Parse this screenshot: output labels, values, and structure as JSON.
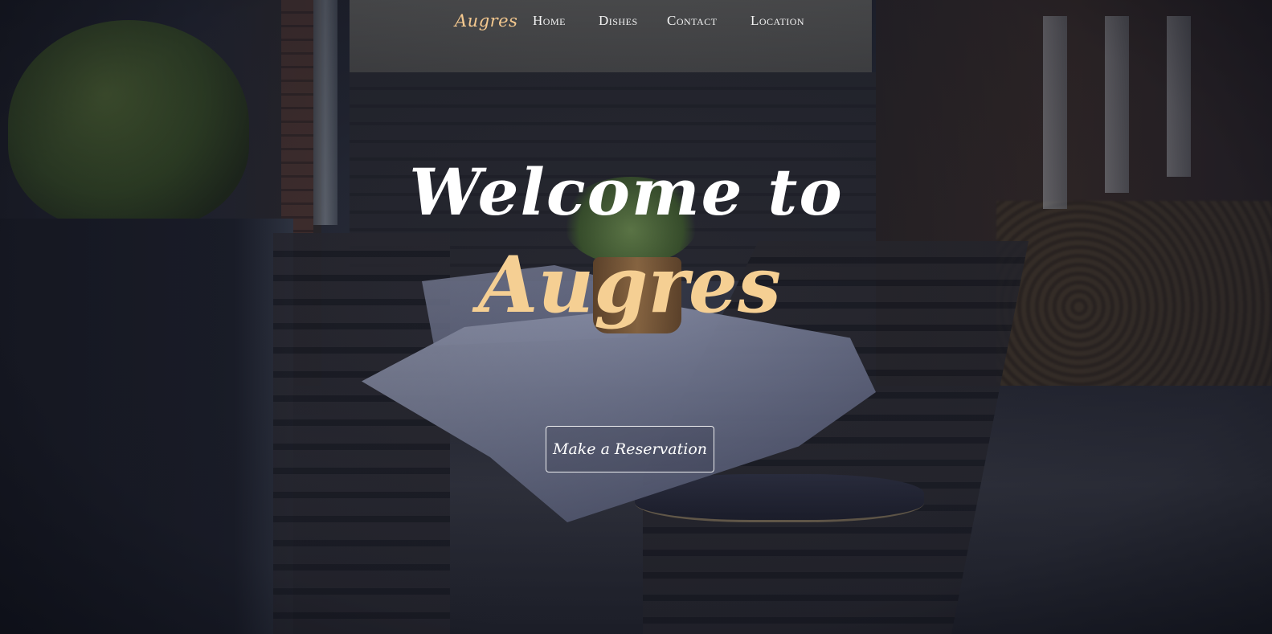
{
  "nav": {
    "brand": "Augres",
    "links": [
      "Home",
      "Dishes",
      "Contact",
      "Location"
    ]
  },
  "hero": {
    "welcome": "Welcome to",
    "brand": "Augres",
    "cta_label": "Make a Reservation"
  },
  "colors": {
    "accent": "#f5c98f",
    "text": "#ffffff",
    "background": "#1a1c26"
  }
}
